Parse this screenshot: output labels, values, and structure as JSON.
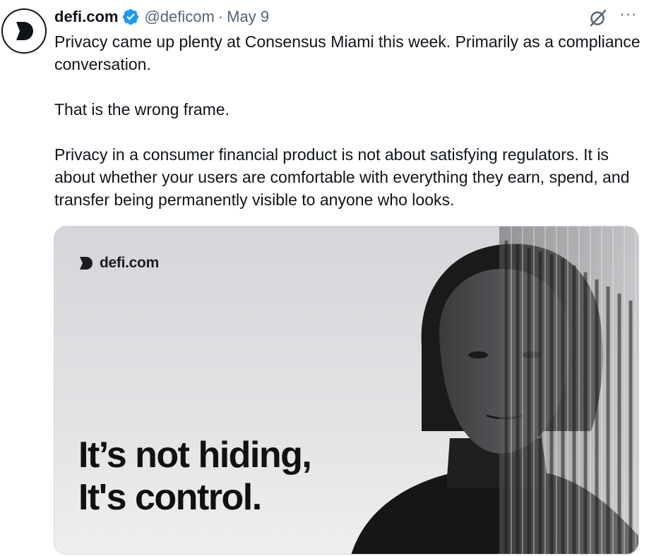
{
  "tweet": {
    "display_name": "defi.com",
    "handle": "@deficom",
    "separator": "·",
    "date": "May 9",
    "more_label": "···",
    "paragraphs": [
      "Privacy came up plenty at Consensus Miami this week. Primarily as a compliance conversation.",
      "That is the wrong frame.",
      "Privacy in a consumer financial product is not about satisfying regulators. It is about whether your users are comfortable with everything they earn, spend, and transfer being permanently visible to anyone who looks."
    ]
  },
  "media": {
    "logo_text": "defi.com",
    "headline_line1": "It’s not hiding,",
    "headline_line2": "It's control."
  },
  "icons": {
    "avatar": "defi-logo-icon",
    "verified": "verified-badge-icon",
    "grok": "grok-icon",
    "more": "more-options-icon"
  },
  "colors": {
    "text_primary": "#0f1419",
    "text_secondary": "#536471",
    "verified_blue": "#1d9bf0",
    "border": "#cfd9de"
  }
}
